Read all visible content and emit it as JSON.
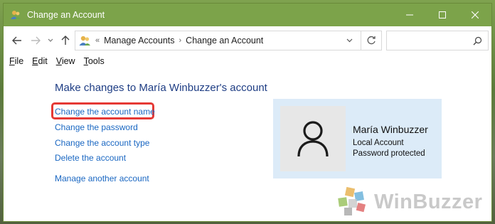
{
  "window": {
    "title": "Change an Account"
  },
  "navigation": {
    "breadcrumb_prefix": "«",
    "breadcrumbs": [
      "Manage Accounts",
      "Change an Account"
    ],
    "search_placeholder": ""
  },
  "menu": {
    "items": [
      {
        "label": "File",
        "access_key": "F",
        "rest": "ile"
      },
      {
        "label": "Edit",
        "access_key": "E",
        "rest": "dit"
      },
      {
        "label": "View",
        "access_key": "V",
        "rest": "iew"
      },
      {
        "label": "Tools",
        "access_key": "T",
        "rest": "ools"
      }
    ]
  },
  "main": {
    "heading": "Make changes to María Winbuzzer's account",
    "tasks": [
      "Change the account name",
      "Change the password",
      "Change the account type",
      "Delete the account"
    ],
    "manage_other": "Manage another account"
  },
  "account": {
    "name": "María Winbuzzer",
    "type": "Local Account",
    "status": "Password protected"
  },
  "watermark": {
    "text": "WinBuzzer"
  },
  "colors": {
    "titlebar": "#7ca34a",
    "link": "#1a67c2",
    "heading": "#1e3d84",
    "highlight": "#e53935",
    "card": "#dcebf8"
  },
  "icons": [
    "users-icon",
    "minimize-icon",
    "maximize-icon",
    "close-icon",
    "back-arrow-icon",
    "forward-arrow-icon",
    "recent-chevron-icon",
    "up-arrow-icon",
    "chevron-down-icon",
    "refresh-icon",
    "search-icon",
    "user-avatar-icon",
    "winbuzzer-logo-icon"
  ]
}
